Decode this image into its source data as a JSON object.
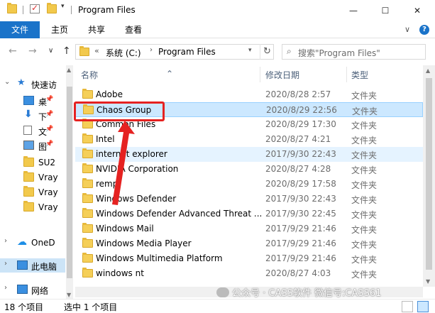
{
  "window": {
    "title": "Program Files",
    "controls": [
      "—",
      "☐",
      "✕"
    ]
  },
  "ribbon": {
    "tabs": [
      "文件",
      "主页",
      "共享",
      "查看"
    ],
    "expand": "∨"
  },
  "nav": {
    "back": "←",
    "forward": "→",
    "recent": "∨",
    "up": "↑",
    "breadcrumb": {
      "chevron": "«",
      "drive": "系统 (C:)",
      "sep": "›",
      "folder": "Program Files"
    },
    "refresh": "↻",
    "search_placeholder": "搜索\"Program Files\""
  },
  "navpane": {
    "quick_access": "快速访",
    "items": [
      {
        "label": "桌",
        "icon": "desktop-icon"
      },
      {
        "label": "下",
        "icon": "download-icon"
      },
      {
        "label": "文",
        "icon": "document-icon"
      },
      {
        "label": "图",
        "icon": "picture-icon"
      },
      {
        "label": "SU2",
        "icon": "folder-icon"
      },
      {
        "label": "Vray",
        "icon": "folder-icon"
      },
      {
        "label": "Vray",
        "icon": "folder-icon"
      },
      {
        "label": "Vray",
        "icon": "folder-icon"
      }
    ],
    "onedrive": "OneD",
    "this_pc": "此电脑",
    "network": "网络"
  },
  "columns": {
    "name": "名称",
    "date": "修改日期",
    "type": "类型"
  },
  "files": [
    {
      "name": "Adobe",
      "date": "2020/8/28 2:57",
      "type": "文件夹",
      "state": ""
    },
    {
      "name": "Chaos Group",
      "date": "2020/8/29 22:56",
      "type": "文件夹",
      "state": "sel"
    },
    {
      "name": "Common Files",
      "date": "2020/8/29 17:30",
      "type": "文件夹",
      "state": ""
    },
    {
      "name": "Intel",
      "date": "2020/8/27 4:21",
      "type": "文件夹",
      "state": ""
    },
    {
      "name": "internet explorer",
      "date": "2017/9/30 22:43",
      "type": "文件夹",
      "state": "hl"
    },
    {
      "name": "NVIDIA Corporation",
      "date": "2020/8/27 4:28",
      "type": "文件夹",
      "state": ""
    },
    {
      "name": "rempl",
      "date": "2020/8/29 17:58",
      "type": "文件夹",
      "state": ""
    },
    {
      "name": "Windows Defender",
      "date": "2017/9/30 22:43",
      "type": "文件夹",
      "state": ""
    },
    {
      "name": "Windows Defender Advanced Threat ...",
      "date": "2017/9/30 22:45",
      "type": "文件夹",
      "state": ""
    },
    {
      "name": "Windows Mail",
      "date": "2017/9/29 21:46",
      "type": "文件夹",
      "state": ""
    },
    {
      "name": "Windows Media Player",
      "date": "2017/9/29 21:46",
      "type": "文件夹",
      "state": ""
    },
    {
      "name": "Windows Multimedia Platform",
      "date": "2017/9/29 21:46",
      "type": "文件夹",
      "state": ""
    },
    {
      "name": "windows nt",
      "date": "2020/8/27 4:03",
      "type": "文件夹",
      "state": ""
    }
  ],
  "status": {
    "count": "18 个项目",
    "selected": "选中 1 个项目"
  },
  "watermark": "公众号 · CASS软件 微信号:CASS61",
  "colors": {
    "accent": "#1a73c9",
    "selection": "#cce8ff",
    "annotation": "#e52221"
  }
}
